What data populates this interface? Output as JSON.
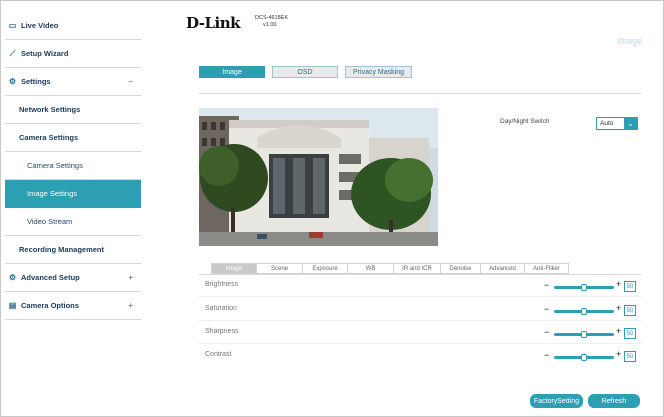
{
  "sidebar": {
    "live_video": "Live Video",
    "setup_wizard": "Setup Wizard",
    "settings": "Settings",
    "settings_sign": "–",
    "network_settings": "Network Settings",
    "camera_settings": "Camera Settings",
    "camera_settings_sub": "Camera Settings",
    "image_settings": "Image Settings",
    "video_stream": "Video Stream",
    "recording_management": "Recording Management",
    "advanced_setup": "Advanced Setup",
    "advanced_sign": "+",
    "camera_options": "Camera Options",
    "camera_options_sign": "+"
  },
  "header": {
    "logo": "D-Link",
    "model": "DCS-4618EK",
    "firmware": "v1.00",
    "page_title_ghost": "Image"
  },
  "page_tabs": [
    "Image",
    "OSD",
    "Privacy Masking"
  ],
  "day_night": {
    "label": "Day/Night Switch",
    "value": "Auto"
  },
  "sub_tabs": [
    "Image",
    "Scene",
    "Exposure",
    "WB",
    "IR and ICR",
    "Denoise",
    "Advanced",
    "Anti-Fliker"
  ],
  "adjustments": [
    {
      "label": "Brightness",
      "value": "50",
      "level": 0.5
    },
    {
      "label": "Saturation",
      "value": "50",
      "level": 0.5
    },
    {
      "label": "Sharpness",
      "value": "50",
      "level": 0.5
    },
    {
      "label": "Contrast",
      "value": "50",
      "level": 0.5
    }
  ],
  "buttons": {
    "factory": "FactorySetting",
    "refresh": "Refresh"
  },
  "colors": {
    "accent": "#2c9fb3",
    "nav_text": "#1a3a5a"
  }
}
